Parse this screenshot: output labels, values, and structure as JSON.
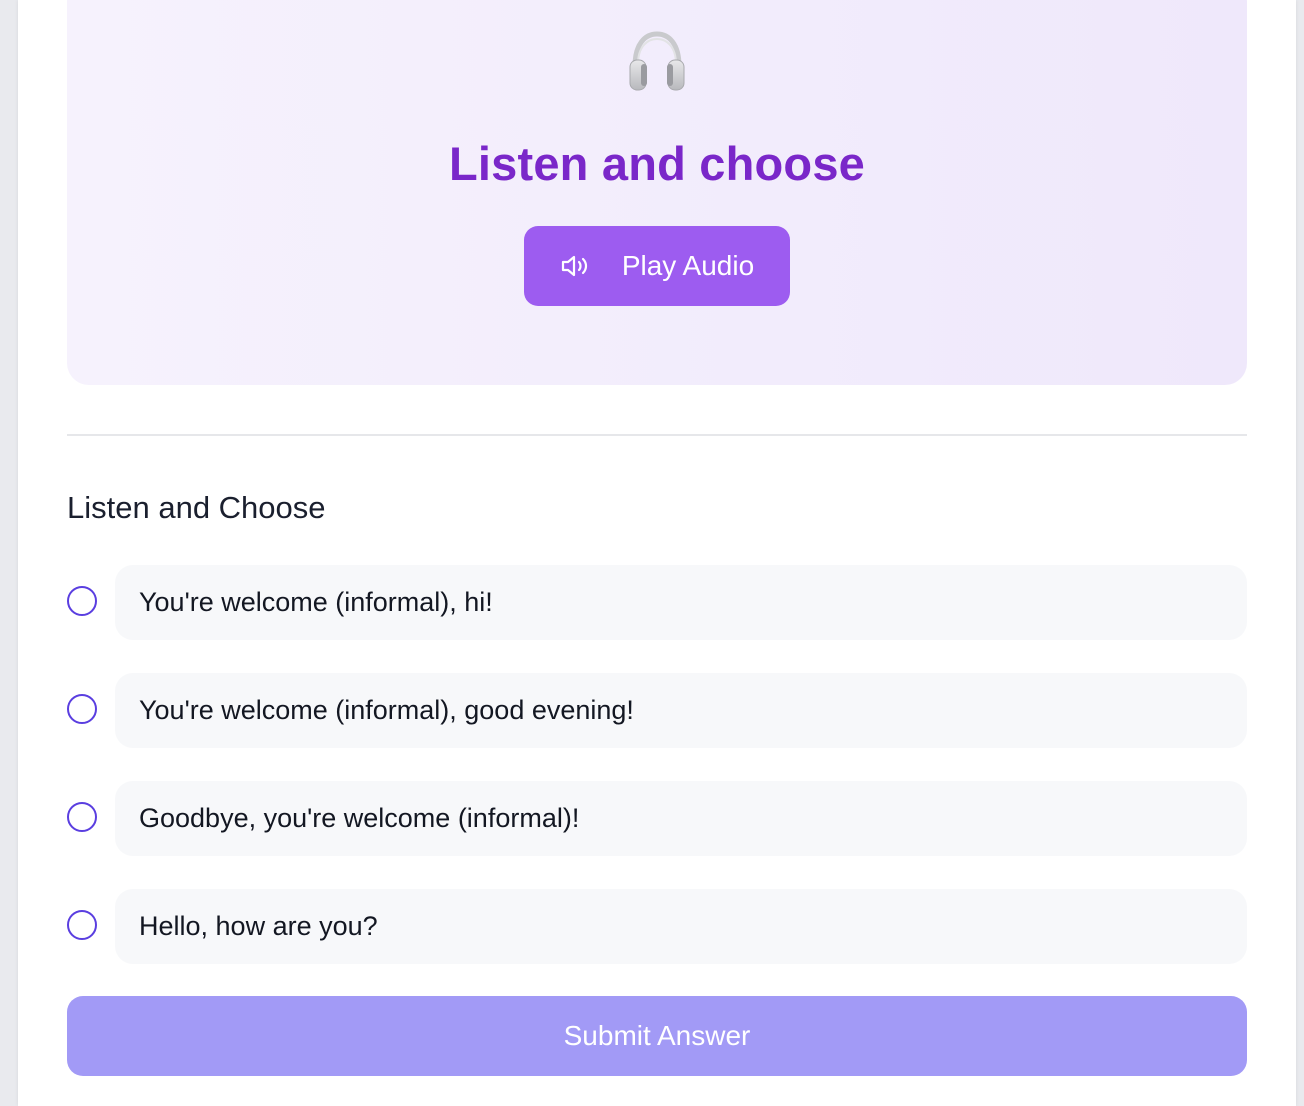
{
  "hero": {
    "icon": "headphones-icon",
    "title": "Listen and choose",
    "play_button": {
      "icon": "speaker-icon",
      "label": "Play Audio"
    }
  },
  "question": {
    "title": "Listen and Choose",
    "options": [
      {
        "label": "You're welcome (informal), hi!"
      },
      {
        "label": "You're welcome (informal), good evening!"
      },
      {
        "label": "Goodbye, you're welcome (informal)!"
      },
      {
        "label": "Hello, how are you?"
      }
    ]
  },
  "submit": {
    "label": "Submit Answer"
  },
  "colors": {
    "accent": "#7a27c9",
    "play_button": "#9d5cf0",
    "radio": "#5a3ee0",
    "submit_button": "#a29af6"
  }
}
